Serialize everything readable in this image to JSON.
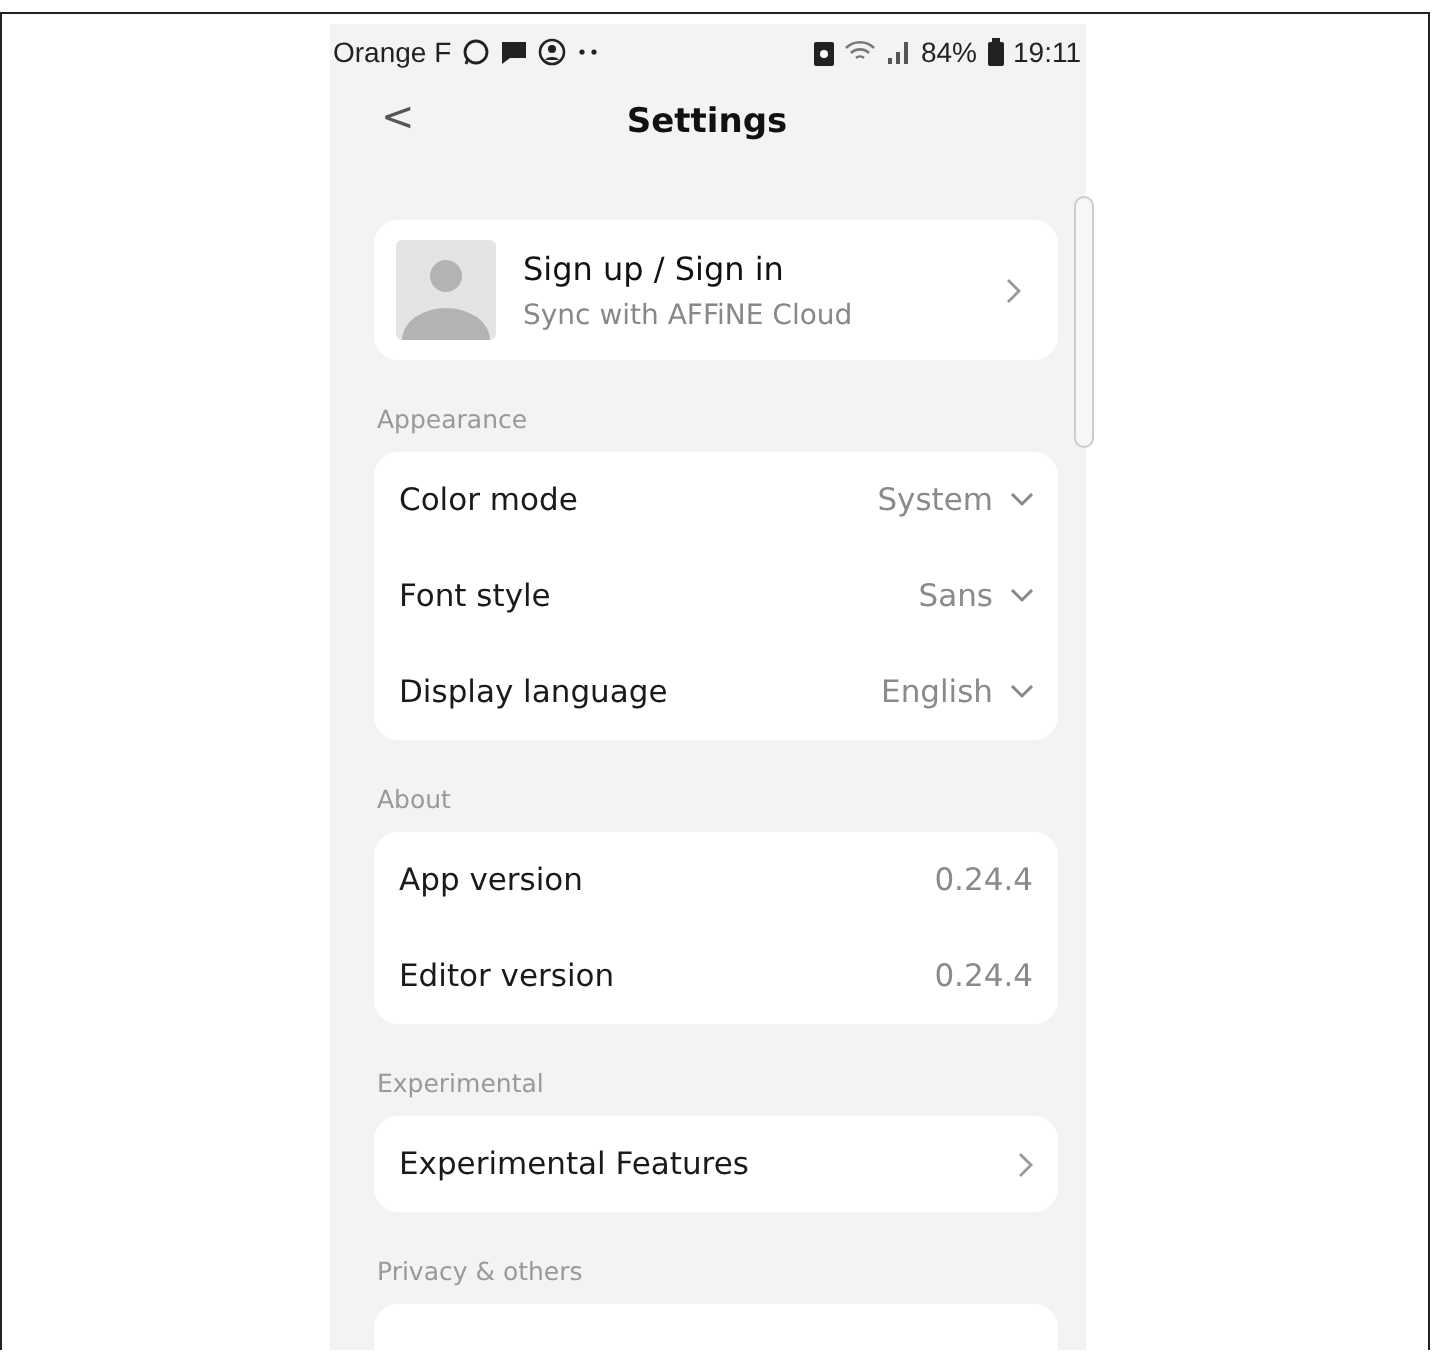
{
  "status_bar": {
    "carrier": "Orange F",
    "battery": "84%",
    "time": "19:11"
  },
  "header": {
    "back": "<",
    "title": "Settings"
  },
  "account": {
    "title": "Sign up / Sign in",
    "subtitle": "Sync with AFFiNE Cloud"
  },
  "sections": [
    {
      "title": "Appearance",
      "rows": [
        {
          "kind": "select",
          "label": "Color mode",
          "value": "System"
        },
        {
          "kind": "select",
          "label": "Font style",
          "value": "Sans"
        },
        {
          "kind": "select",
          "label": "Display language",
          "value": "English"
        }
      ]
    },
    {
      "title": "About",
      "rows": [
        {
          "kind": "info",
          "label": "App version",
          "value": "0.24.4"
        },
        {
          "kind": "info",
          "label": "Editor version",
          "value": "0.24.4"
        }
      ]
    },
    {
      "title": "Experimental",
      "rows": [
        {
          "kind": "link",
          "label": "Experimental Features"
        }
      ]
    },
    {
      "title": "Privacy & others"
    }
  ]
}
